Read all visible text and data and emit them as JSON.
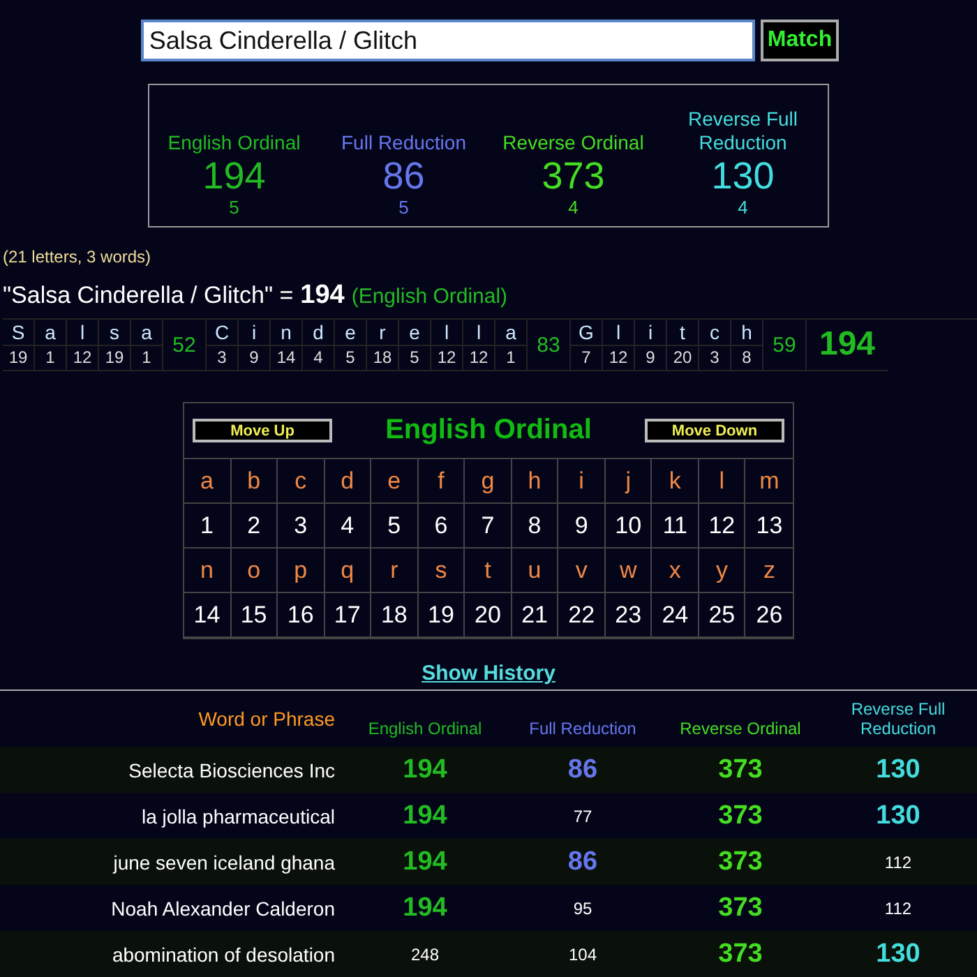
{
  "search": {
    "value": "Salsa Cinderella / Glitch",
    "button": "Match"
  },
  "ciphers": [
    {
      "name": "English Ordinal",
      "value": "194",
      "words": "5",
      "color": "#22bb22"
    },
    {
      "name": "Full Reduction",
      "value": "86",
      "words": "5",
      "color": "#6677ee"
    },
    {
      "name": "Reverse Ordinal",
      "value": "373",
      "words": "4",
      "color": "#44dd22"
    },
    {
      "name": "Reverse Full Reduction",
      "value": "130",
      "words": "4",
      "color": "#44dddd"
    }
  ],
  "counts": "(21 letters, 3 words)",
  "result": {
    "phrase": "\"Salsa Cinderella / Glitch\" =",
    "value": "194",
    "cipher": "(English Ordinal)"
  },
  "breakdown": {
    "words": [
      {
        "letters": [
          {
            "char": "S",
            "value": "19"
          },
          {
            "char": "a",
            "value": "1"
          },
          {
            "char": "l",
            "value": "12"
          },
          {
            "char": "s",
            "value": "19"
          },
          {
            "char": "a",
            "value": "1"
          }
        ],
        "total": "52"
      },
      {
        "letters": [
          {
            "char": "C",
            "value": "3"
          },
          {
            "char": "i",
            "value": "9"
          },
          {
            "char": "n",
            "value": "14"
          },
          {
            "char": "d",
            "value": "4"
          },
          {
            "char": "e",
            "value": "5"
          },
          {
            "char": "r",
            "value": "18"
          },
          {
            "char": "e",
            "value": "5"
          },
          {
            "char": "l",
            "value": "12"
          },
          {
            "char": "l",
            "value": "12"
          },
          {
            "char": "a",
            "value": "1"
          }
        ],
        "total": "83"
      },
      {
        "letters": [
          {
            "char": "G",
            "value": "7"
          },
          {
            "char": "l",
            "value": "12"
          },
          {
            "char": "i",
            "value": "9"
          },
          {
            "char": "t",
            "value": "20"
          },
          {
            "char": "c",
            "value": "3"
          },
          {
            "char": "h",
            "value": "8"
          }
        ],
        "total": "59"
      }
    ],
    "total": "194"
  },
  "chart": {
    "move_up": "Move Up",
    "title": "English Ordinal",
    "move_down": "Move Down",
    "rows": [
      {
        "letters": [
          "a",
          "b",
          "c",
          "d",
          "e",
          "f",
          "g",
          "h",
          "i",
          "j",
          "k",
          "l",
          "m"
        ],
        "values": [
          "1",
          "2",
          "3",
          "4",
          "5",
          "6",
          "7",
          "8",
          "9",
          "10",
          "11",
          "12",
          "13"
        ]
      },
      {
        "letters": [
          "n",
          "o",
          "p",
          "q",
          "r",
          "s",
          "t",
          "u",
          "v",
          "w",
          "x",
          "y",
          "z"
        ],
        "values": [
          "14",
          "15",
          "16",
          "17",
          "18",
          "19",
          "20",
          "21",
          "22",
          "23",
          "24",
          "25",
          "26"
        ]
      }
    ]
  },
  "history": {
    "toggle": "Show History",
    "phrase_header": "Word or Phrase",
    "columns": [
      {
        "name": "English Ordinal",
        "color": "#22bb22"
      },
      {
        "name": "Full Reduction",
        "color": "#6677ee"
      },
      {
        "name": "Reverse Ordinal",
        "color": "#44dd22"
      },
      {
        "name": "Reverse Full Reduction",
        "color": "#44dddd"
      }
    ],
    "rows": [
      {
        "phrase": "Selecta Biosciences Inc",
        "cells": [
          {
            "value": "194",
            "match": true
          },
          {
            "value": "86",
            "match": true
          },
          {
            "value": "373",
            "match": true
          },
          {
            "value": "130",
            "match": true
          }
        ]
      },
      {
        "phrase": "la jolla pharmaceutical",
        "cells": [
          {
            "value": "194",
            "match": true
          },
          {
            "value": "77",
            "match": false
          },
          {
            "value": "373",
            "match": true
          },
          {
            "value": "130",
            "match": true
          }
        ]
      },
      {
        "phrase": "june seven iceland ghana",
        "cells": [
          {
            "value": "194",
            "match": true
          },
          {
            "value": "86",
            "match": true
          },
          {
            "value": "373",
            "match": true
          },
          {
            "value": "112",
            "match": false
          }
        ]
      },
      {
        "phrase": "Noah Alexander Calderon",
        "cells": [
          {
            "value": "194",
            "match": true
          },
          {
            "value": "95",
            "match": false
          },
          {
            "value": "373",
            "match": true
          },
          {
            "value": "112",
            "match": false
          }
        ]
      },
      {
        "phrase": "abomination of desolation",
        "cells": [
          {
            "value": "248",
            "match": false
          },
          {
            "value": "104",
            "match": false
          },
          {
            "value": "373",
            "match": true
          },
          {
            "value": "130",
            "match": true
          }
        ]
      }
    ]
  }
}
